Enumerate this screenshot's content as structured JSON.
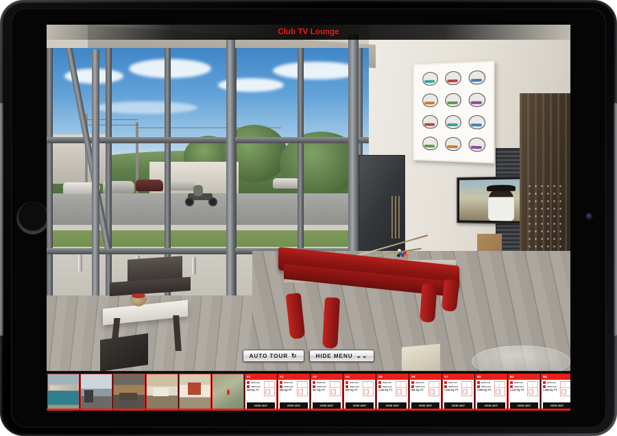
{
  "device": {
    "type": "tablet",
    "orientation": "landscape"
  },
  "viewer": {
    "scene_title": "Club TV Lounge",
    "title_color": "#ff1a1a",
    "scene_description": "Club TV lounge interior with red pool table, floor-to-ceiling windows and wall-mounted TV",
    "controls": [
      {
        "label": "AUTO TOUR",
        "icon": "rotate-icon",
        "glyph": "↻"
      },
      {
        "label": "HIDE MENU",
        "icon": "chevron-double-down-icon",
        "glyph": "⌄⌄"
      }
    ]
  },
  "menu_strip": {
    "accent_color": "#e8201a",
    "photo_thumbnails": [
      {
        "name": "pool-deck",
        "style": "t-pool"
      },
      {
        "name": "fitness-center",
        "style": "t-gym"
      },
      {
        "name": "clubhouse-lounge",
        "style": "t-lobby"
      },
      {
        "name": "model-kitchen",
        "style": "t-kitch"
      },
      {
        "name": "model-bathroom",
        "style": "t-bath"
      },
      {
        "name": "area-map",
        "style": "t-map"
      }
    ],
    "floor_plan_labels": {
      "bedroom": "Bedroom",
      "bathroom": "Bathroom",
      "view_unit": "VIEW UNIT"
    },
    "floor_plans": [
      {
        "code": "E1",
        "bedrooms": "1",
        "bathrooms": "1",
        "area": "628 SQ. FT."
      },
      {
        "code": "A1",
        "bedrooms": "1",
        "bathrooms": "1",
        "area": "680 SQ. FT."
      },
      {
        "code": "A3",
        "bedrooms": "1",
        "bathrooms": "1",
        "area": "847 SQ. FT."
      },
      {
        "code": "A4",
        "bedrooms": "1",
        "bathrooms": "1",
        "area": "800 SQ. FT."
      },
      {
        "code": "A5",
        "bedrooms": "1",
        "bathrooms": "1",
        "area": "1,116 SQ. FT."
      },
      {
        "code": "A6",
        "bedrooms": "1",
        "bathrooms": "1",
        "area": "860 SQ. FT."
      },
      {
        "code": "A7",
        "bedrooms": "1",
        "bathrooms": "1",
        "area": "1,040 SQ. FT."
      },
      {
        "code": "B2",
        "bedrooms": "2",
        "bathrooms": "2",
        "area": "1,050 SQ. FT."
      },
      {
        "code": "B3",
        "bedrooms": "2",
        "bathrooms": "2",
        "area": "1,131 SQ. FT."
      },
      {
        "code": "B4",
        "bedrooms": "2",
        "bathrooms": "2",
        "area": "1,068 SQ. FT."
      }
    ]
  }
}
